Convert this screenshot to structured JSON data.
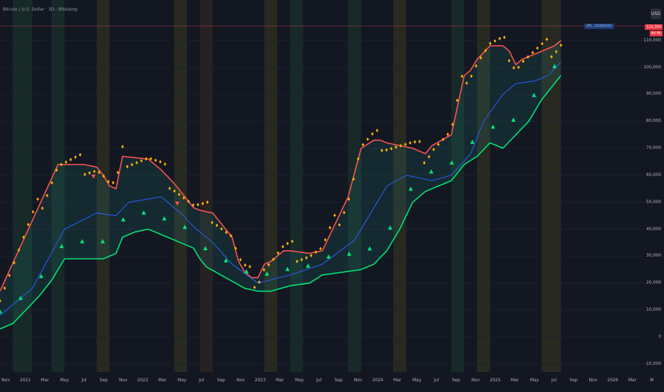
{
  "header": {
    "title": "Bitcoin / U.S. Dollar · 3D · Bitstamp"
  },
  "currency_badge": "USD",
  "price_tags": [
    "115,300",
    "4d 8h"
  ],
  "blue_tag": "ATL 10000000",
  "chart_data": {
    "type": "line",
    "title": "Bitcoin / U.S. Dollar · 3D · Bitstamp",
    "xlabel": "",
    "ylabel": "",
    "ylim": [
      -13000,
      125000
    ],
    "xlim": [
      0,
      1
    ],
    "y_ticks": [
      "110,000",
      "100,000",
      "90,000",
      "80,000",
      "70,000",
      "60,000",
      "50,000",
      "40,000",
      "30,000",
      "20,000",
      "10,000",
      "0",
      "-10,000"
    ],
    "y_tick_values": [
      110000,
      100000,
      90000,
      80000,
      70000,
      60000,
      50000,
      40000,
      30000,
      20000,
      10000,
      0,
      -10000
    ],
    "x_ticks": [
      "Nov",
      "2021",
      "Mar",
      "May",
      "Jul",
      "Sep",
      "Nov",
      "2022",
      "Mar",
      "May",
      "Jul",
      "Sep",
      "Nov",
      "2023",
      "Mar",
      "May",
      "Jul",
      "Sep",
      "Nov",
      "2024",
      "Mar",
      "May",
      "Jul",
      "Sep",
      "Nov",
      "2025",
      "Mar",
      "May",
      "Jul",
      "Sep",
      "Nov",
      "2026",
      "Mar",
      "M"
    ],
    "grid": true,
    "series": [
      {
        "color": "#ff5252",
        "x": [
          0.0,
          0.09,
          0.13,
          0.15,
          0.16,
          0.17,
          0.18,
          0.19,
          0.23,
          0.25,
          0.27,
          0.29,
          0.3,
          0.31,
          0.33,
          0.36,
          0.37,
          0.38,
          0.39,
          0.4,
          0.41,
          0.42,
          0.44,
          0.45,
          0.48,
          0.5,
          0.54,
          0.56,
          0.58,
          0.59,
          0.6,
          0.62,
          0.64,
          0.65,
          0.66,
          0.67,
          0.7,
          0.71,
          0.72,
          0.73,
          0.74,
          0.76,
          0.78,
          0.79,
          0.8,
          0.81,
          0.86,
          0.87
        ],
        "y": [
          17000,
          64000,
          64000,
          63000,
          60000,
          56000,
          55000,
          67000,
          66000,
          62000,
          57000,
          51000,
          48000,
          47000,
          46000,
          37000,
          28000,
          24000,
          22000,
          22000,
          27000,
          28000,
          32000,
          32000,
          31000,
          32000,
          52000,
          70000,
          73000,
          73000,
          72000,
          71000,
          70000,
          69000,
          68000,
          71000,
          75000,
          86000,
          97000,
          99000,
          103000,
          108000,
          108000,
          106000,
          101000,
          103000,
          108000,
          110000
        ]
      },
      {
        "color": "#00e676",
        "x": [
          0.0,
          0.02,
          0.04,
          0.06,
          0.08,
          0.1,
          0.12,
          0.16,
          0.17,
          0.18,
          0.19,
          0.21,
          0.23,
          0.25,
          0.28,
          0.3,
          0.31,
          0.32,
          0.35,
          0.38,
          0.4,
          0.42,
          0.45,
          0.48,
          0.5,
          0.53,
          0.56,
          0.58,
          0.6,
          0.62,
          0.64,
          0.66,
          0.68,
          0.7,
          0.72,
          0.74,
          0.76,
          0.78,
          0.8,
          0.82,
          0.84,
          0.87
        ],
        "y": [
          3000,
          5000,
          10000,
          15000,
          21000,
          29000,
          29000,
          29000,
          30000,
          31000,
          37000,
          39000,
          40000,
          38000,
          35000,
          33000,
          29000,
          26000,
          22000,
          18000,
          17000,
          17000,
          19000,
          20000,
          23000,
          24000,
          25000,
          27000,
          32000,
          40000,
          50000,
          54000,
          56000,
          58000,
          64000,
          67000,
          72000,
          70000,
          75000,
          80000,
          88000,
          97000
        ]
      },
      {
        "color": "#2962ff",
        "x": [
          0.0,
          0.05,
          0.1,
          0.15,
          0.18,
          0.2,
          0.25,
          0.28,
          0.3,
          0.33,
          0.36,
          0.4,
          0.45,
          0.5,
          0.55,
          0.6,
          0.63,
          0.67,
          0.7,
          0.73,
          0.75,
          0.78,
          0.8,
          0.83,
          0.85,
          0.87
        ],
        "y": [
          8000,
          18000,
          40000,
          46000,
          45000,
          50000,
          52000,
          46000,
          41000,
          35000,
          27000,
          20000,
          23000,
          27000,
          36000,
          56000,
          60000,
          58000,
          60000,
          68000,
          80000,
          90000,
          94000,
          95000,
          97000,
          102000
        ]
      }
    ],
    "markers": {
      "green_triangles": 28,
      "red_triangles": 2,
      "yellow_diamonds": 120
    }
  }
}
